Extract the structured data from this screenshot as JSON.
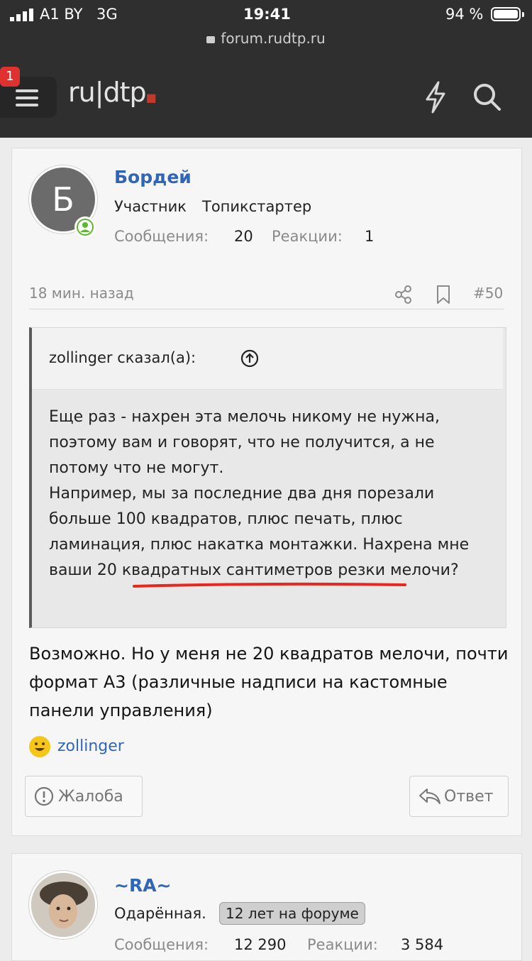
{
  "status_bar": {
    "carrier": "A1 BY",
    "network": "3G",
    "time": "19:41",
    "battery": "94 %"
  },
  "browser": {
    "url": "forum.rudtp.ru"
  },
  "header": {
    "notification_count": "1",
    "logo_text": "ru|dtp"
  },
  "post1": {
    "avatar_letter": "Б",
    "username": "Бордей",
    "role": "Участник",
    "badge": "Топикстартер",
    "messages_label": "Сообщения:",
    "messages_value": "20",
    "reactions_label": "Реакции:",
    "reactions_value": "1",
    "time": "18 мин. назад",
    "post_number": "#50",
    "quote_author": "zollinger сказал(а):",
    "quote_text": "Еще раз - нахрен эта мелочь никому не нужна, поэтому вам и говорят, что не получится, а не потому что не могут.\nНапример, мы за последние два дня порезали больше 100 квадратов, плюс печать, плюс ламинация, плюс накатка монтажки. Нахрена мне ваши 20 квадратных сантиметров резки мелочи?",
    "body": "Возможно. Но у меня не 20 квадратов мелочи, почти формат А3 (различные надписи на кастомные панели управления)",
    "reaction_user": "zollinger",
    "report_label": "Жалоба",
    "reply_label": "Ответ"
  },
  "post2": {
    "username": "~RA~",
    "role": "Одарённая.",
    "badge": "12 лет на форуме",
    "messages_label": "Сообщения:",
    "messages_value": "12 290",
    "reactions_label": "Реакции:",
    "reactions_value": "3 584"
  },
  "colors": {
    "accent": "#2f66b8",
    "header_bg": "#2f2f2f",
    "highlight_underline": "#e8281e",
    "online": "#5cb82e"
  }
}
